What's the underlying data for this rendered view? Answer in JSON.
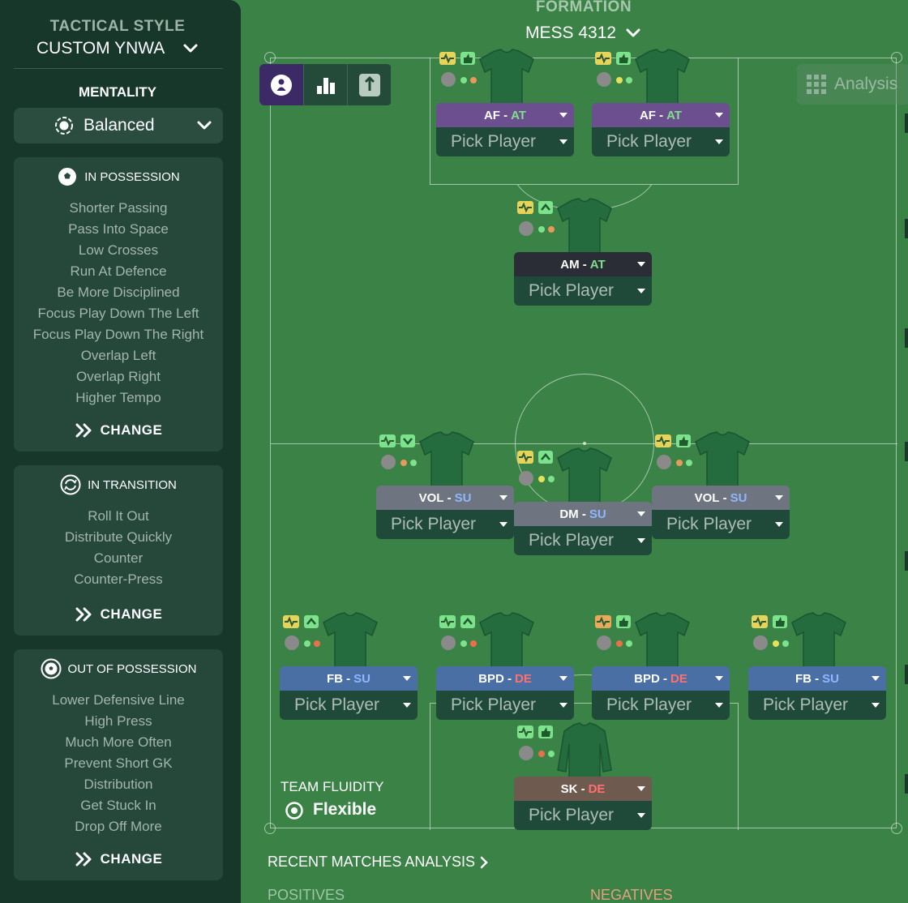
{
  "sidebar": {
    "tactical_style_label": "TACTICAL STYLE",
    "tactical_style_value": "CUSTOM YNWA",
    "mentality_label": "MENTALITY",
    "mentality_value": "Balanced",
    "in_possession": {
      "title": "IN POSSESSION",
      "items": [
        "Shorter Passing",
        "Pass Into Space",
        "Low Crosses",
        "Run At Defence",
        "Be More Disciplined",
        "Focus Play Down The Left",
        "Focus Play Down The Right",
        "Overlap Left",
        "Overlap Right",
        "Higher Tempo"
      ],
      "change_label": "CHANGE"
    },
    "in_transition": {
      "title": "IN TRANSITION",
      "items": [
        "Roll It Out",
        "Distribute Quickly",
        "Counter",
        "Counter-Press"
      ],
      "change_label": "CHANGE"
    },
    "out_of_possession": {
      "title": "OUT OF POSSESSION",
      "items": [
        "Lower Defensive Line",
        "High Press",
        "Much More Often",
        "Prevent Short GK",
        "Distribution",
        "Get Stuck In",
        "Drop Off More"
      ],
      "change_label": "CHANGE"
    }
  },
  "formation": {
    "label": "FORMATION",
    "value": "MESS 4312"
  },
  "analysis_label": "Analysis",
  "pick_label": "Pick Player",
  "players": [
    {
      "role": "AF",
      "duty": "AT",
      "duty_color": "#7ee08c",
      "bar_color": "#6b4f8e"
    },
    {
      "role": "AF",
      "duty": "AT",
      "duty_color": "#7ee08c",
      "bar_color": "#6b4f8e"
    },
    {
      "role": "AM",
      "duty": "AT",
      "duty_color": "#7ee08c",
      "bar_color": "#2b2d36"
    },
    {
      "role": "VOL",
      "duty": "SU",
      "duty_color": "#8fb7ff",
      "bar_color": "#6e7480"
    },
    {
      "role": "DM",
      "duty": "SU",
      "duty_color": "#8fb7ff",
      "bar_color": "#6e7480"
    },
    {
      "role": "VOL",
      "duty": "SU",
      "duty_color": "#8fb7ff",
      "bar_color": "#6e7480"
    },
    {
      "role": "FB",
      "duty": "SU",
      "duty_color": "#8fb7ff",
      "bar_color": "#4a6fa5"
    },
    {
      "role": "BPD",
      "duty": "DE",
      "duty_color": "#ff7070",
      "bar_color": "#4a6fa5"
    },
    {
      "role": "BPD",
      "duty": "DE",
      "duty_color": "#ff7070",
      "bar_color": "#4a6fa5"
    },
    {
      "role": "FB",
      "duty": "SU",
      "duty_color": "#8fb7ff",
      "bar_color": "#4a6fa5"
    },
    {
      "role": "SK",
      "duty": "DE",
      "duty_color": "#ff7070",
      "bar_color": "#6e5a4e"
    }
  ],
  "team_fluidity": {
    "label": "TEAM FLUIDITY",
    "value": "Flexible"
  },
  "recent_matches_label": "RECENT MATCHES ANALYSIS",
  "positives_label": "POSITIVES",
  "negatives_label": "NEGATIVES"
}
